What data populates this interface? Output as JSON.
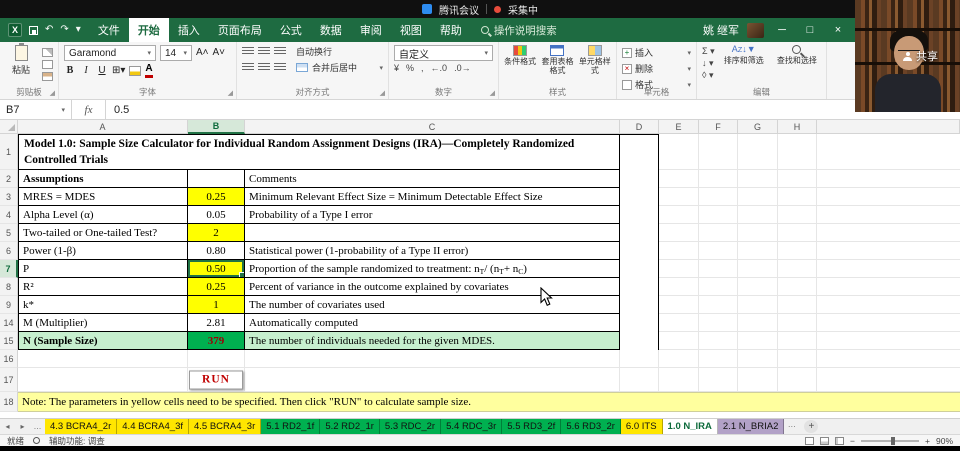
{
  "meeting_bar": {
    "app_name": "腾讯会议",
    "recording_status": "采集中"
  },
  "title_bar": {
    "tabs": [
      {
        "label": "文件"
      },
      {
        "label": "开始"
      },
      {
        "label": "插入"
      },
      {
        "label": "页面布局"
      },
      {
        "label": "公式"
      },
      {
        "label": "数据"
      },
      {
        "label": "审阅"
      },
      {
        "label": "视图"
      },
      {
        "label": "帮助"
      }
    ],
    "search_placeholder": "操作说明搜索",
    "user_name": "姚 继军",
    "share_label": "共享"
  },
  "ribbon": {
    "clipboard": {
      "group_label": "剪贴板",
      "paste_label": "粘贴"
    },
    "font": {
      "group_label": "字体",
      "font_family": "Garamond",
      "font_size": "14",
      "bold": "B",
      "italic": "I",
      "underline": "U"
    },
    "alignment": {
      "group_label": "对齐方式",
      "wrap_label": "自动换行",
      "merge_label": "合并后居中"
    },
    "number": {
      "group_label": "数字",
      "format_value": "自定义",
      "currency": "¥",
      "percent": "%",
      "comma": ",",
      "inc_dec": "←.0",
      "dec_dec": ".0→"
    },
    "styles": {
      "group_label": "样式",
      "conditional_label": "条件格式",
      "table_format_label": "套用表格格式",
      "cell_styles_label": "单元格样式"
    },
    "cells": {
      "group_label": "单元格",
      "insert_label": "插入",
      "delete_label": "删除",
      "format_label": "格式"
    },
    "editing": {
      "group_label": "编辑",
      "autosum": "Σ",
      "sort_label": "排序和筛选",
      "find_label": "查找和选择"
    }
  },
  "formula_bar": {
    "name_box": "B7",
    "fx_label": "fx",
    "formula_value": "0.5"
  },
  "sheet": {
    "columns": [
      "A",
      "B",
      "C",
      "D",
      "E",
      "F",
      "G",
      "H"
    ],
    "r1": {
      "num": "1",
      "title": "Model 1.0:  Sample Size Calculator for Individual Random Assignment Designs (IRA)—Completely Randomized Controlled Trials"
    },
    "r2": {
      "num": "2",
      "a": "Assumptions",
      "c": "Comments"
    },
    "r3": {
      "num": "3",
      "a": "MRES = MDES",
      "b": "0.25",
      "c": "Minimum Relevant Effect Size = Minimum Detectable Effect Size"
    },
    "r4": {
      "num": "4",
      "a": "Alpha Level (α)",
      "b": "0.05",
      "c": "Probability of a Type I error"
    },
    "r5": {
      "num": "5",
      "a": "Two-tailed or One-tailed Test?",
      "b": "2",
      "c": ""
    },
    "r6": {
      "num": "6",
      "a": "Power (1-β)",
      "b": "0.80",
      "c": "Statistical power (1-probability of a Type II error)"
    },
    "r7": {
      "num": "7",
      "a": "P",
      "b": "0.50",
      "c1": "Proportion of the sample randomized to treatment:  n",
      "sub1": "T",
      "c2": " / (n",
      "sub2": "T",
      "c3": " + n",
      "sub3": "C",
      "c4": ")"
    },
    "r8": {
      "num": "8",
      "a": "R²",
      "b": "0.25",
      "c": "Percent of variance in the outcome explained by covariates"
    },
    "r9": {
      "num": "9",
      "a": "k*",
      "b": "1",
      "c": "The number of covariates used"
    },
    "r14": {
      "num": "14",
      "a": "M (Multiplier)",
      "b": "2.81",
      "c": "Automatically computed"
    },
    "r15": {
      "num": "15",
      "a": "N (Sample Size)",
      "b": "379",
      "c": "The number of individuals needed for the given MDES."
    },
    "r16": {
      "num": "16"
    },
    "r17": {
      "num": "17",
      "run_label": "RUN"
    },
    "r18": {
      "num": "18",
      "note": "Note: The parameters in yellow cells need to be specified. Then click \"RUN\" to calculate sample size."
    }
  },
  "sheet_tabs": [
    {
      "label": "4.3 BCRA4_2r",
      "color": "#FFE600"
    },
    {
      "label": "4.4 BCRA4_3f",
      "color": "#FFE600"
    },
    {
      "label": "4.5 BCRA4_3r",
      "color": "#FFE600"
    },
    {
      "label": "5.1 RD2_1f",
      "color": "#00B050"
    },
    {
      "label": "5.2 RD2_1r",
      "color": "#00B050"
    },
    {
      "label": "5.3 RDC_2r",
      "color": "#00B050"
    },
    {
      "label": "5.4 RDC_3r",
      "color": "#00B050"
    },
    {
      "label": "5.5 RD3_2f",
      "color": "#00B050"
    },
    {
      "label": "5.6 RD3_2r",
      "color": "#00B050"
    },
    {
      "label": "6.0 ITS",
      "color": "#FFE600"
    },
    {
      "label": "1.0 N_IRA",
      "color": "active"
    },
    {
      "label": "2.1 N_BRIA2",
      "color": "#B2A1C7"
    }
  ],
  "status_bar": {
    "ready": "就绪",
    "accessibility": "辅助功能: 调查",
    "zoom": "90%"
  },
  "colors": {
    "excel_green": "#1E6B41",
    "yellow_cell": "#FFFF00",
    "result_bg": "#00B050",
    "result_text": "#9C0006",
    "good_bg": "#C6EFCE",
    "note_bg": "#FFFF9E"
  }
}
